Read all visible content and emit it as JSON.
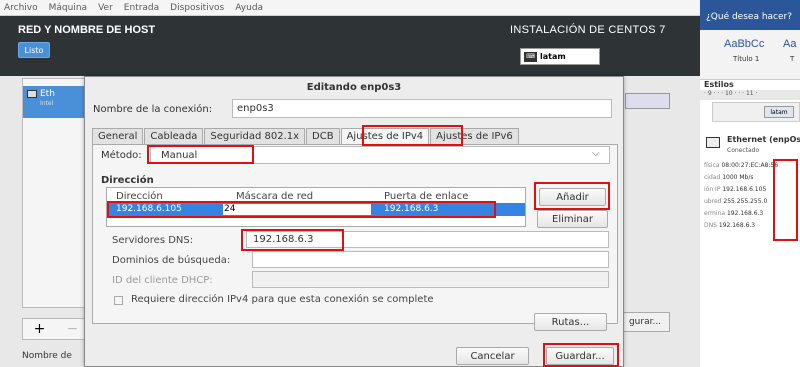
{
  "vbox_menu": [
    "Archivo",
    "Máquina",
    "Ver",
    "Entrada",
    "Dispositivos",
    "Ayuda"
  ],
  "header": {
    "title": "RED Y NOMBRE DE HOST",
    "done_label": "Listo",
    "product": "INSTALACIÓN DE CENTOS 7",
    "keyboard_layout": "latam"
  },
  "device": {
    "name": "Eth",
    "sub": "Intel",
    "hostname_label": "Nombre de",
    "configure_label": "gurar...",
    "add": "+",
    "remove": "−"
  },
  "dialog": {
    "title": "Editando enp0s3",
    "connection_label": "Nombre de la conexión:",
    "connection_value": "enp0s3",
    "tabs": [
      "General",
      "Cableada",
      "Seguridad 802.1x",
      "DCB",
      "Ajustes de IPv4",
      "Ajustes de IPv6"
    ],
    "active_tab": "Ajustes de IPv4",
    "method_label": "Método:",
    "method_value": "Manual",
    "address_section": "Dirección",
    "columns": [
      "Dirección",
      "Máscara de red",
      "Puerta de enlace"
    ],
    "address_row": {
      "address": "192.168.6.105",
      "netmask": "24",
      "gateway": "192.168.6.3"
    },
    "add_button": "Añadir",
    "delete_button": "Eliminar",
    "dns_label": "Servidores DNS:",
    "dns_value": "192.168.6.3",
    "search_label": "Dominios de búsqueda:",
    "search_value": "",
    "dhcp_label": "ID del cliente DHCP:",
    "dhcp_value": "",
    "require_label": "Requiere dirección IPv4 para que esta conexión se complete",
    "routes_button": "Rutas...",
    "cancel_button": "Cancelar",
    "save_button": "Guardar..."
  },
  "word": {
    "help_title": "¿Qué desea hacer?",
    "style_samples": [
      "AaBbCc",
      "Aa"
    ],
    "style_names": [
      "Título 1",
      "T"
    ],
    "styles_label": "Estilos",
    "ruler_text": "· 9 · · · 10 · · · 11 ·",
    "ethernet_title": "Ethernet (enpOs",
    "connected": "Conectado",
    "info": [
      {
        "label": "física",
        "value": "08:00:27:EC:A8:56"
      },
      {
        "label": "cidad",
        "value": "1000 Mb/s"
      },
      {
        "label": "ión IP",
        "value": "192.168.6.105"
      },
      {
        "label": "ubred",
        "value": "255.255.255.0"
      },
      {
        "label": "ermina",
        "value": "192.168.6.3"
      },
      {
        "label": "DNS",
        "value": "192.168.6.3"
      }
    ]
  },
  "colors": {
    "header_bg": "#2e3436",
    "selection": "#3584e4",
    "highlight_box": "#e01010"
  }
}
